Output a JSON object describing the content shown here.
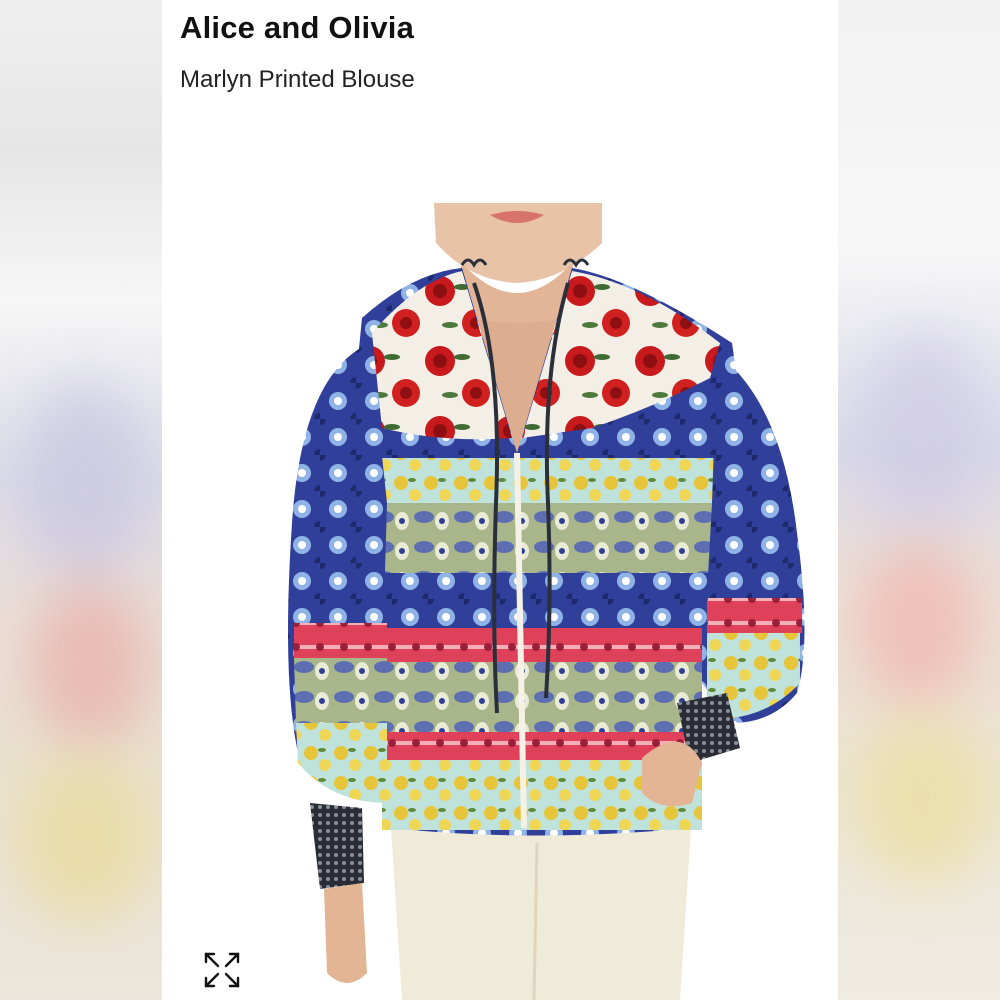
{
  "header": {
    "brand": "Alice and Olivia",
    "product_name": "Marlyn Printed Blouse"
  },
  "gallery": {
    "image_subject": "model-wearing-patchwork-print-blouse",
    "expand_icon": "expand-arrows-icon"
  },
  "colors": {
    "background": "#f4f4f4",
    "card": "#ffffff",
    "text": "#111111",
    "rose_red": "#c8191c",
    "cobalt_blue": "#2f3f9a",
    "marigold": "#e6c53a",
    "coral": "#e0415a",
    "sage": "#a9b58a"
  }
}
